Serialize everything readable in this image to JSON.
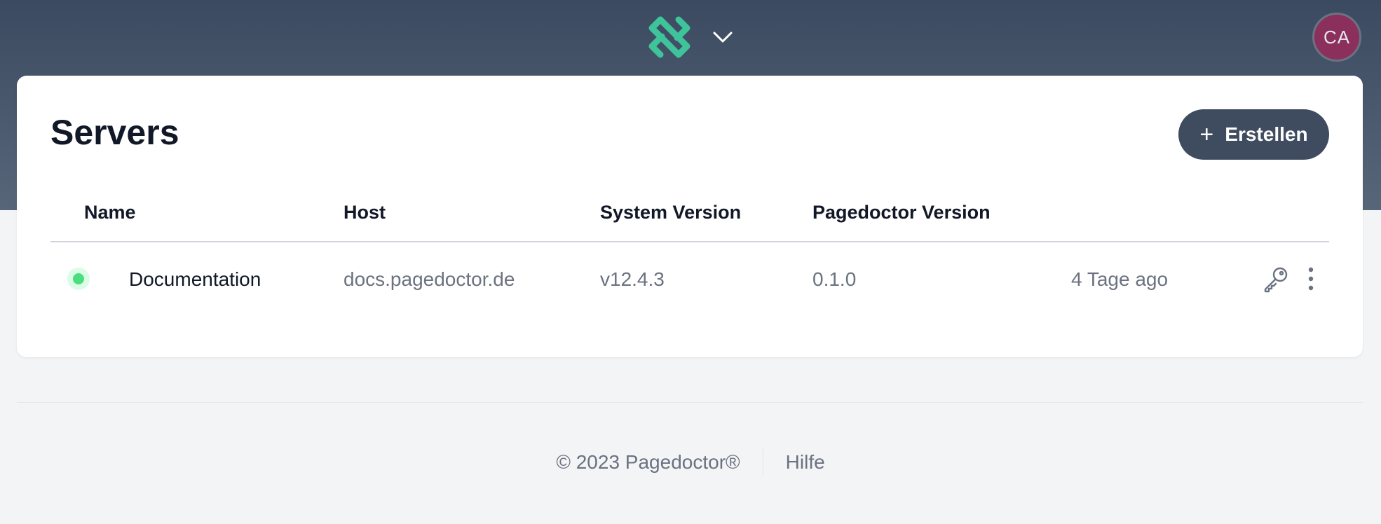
{
  "header": {
    "logo_icon": "pagedoctor-logo-icon",
    "dropdown_icon": "chevron-down-icon",
    "avatar_initials": "CA",
    "logo_color": "#3fc39a",
    "avatar_color": "#8b2f5c"
  },
  "page": {
    "title": "Servers",
    "create_label": "Erstellen",
    "create_icon": "plus-icon"
  },
  "table": {
    "columns": [
      "Name",
      "Host",
      "System Version",
      "Pagedoctor Version"
    ],
    "rows": [
      {
        "status": "online",
        "status_color": "#4ade80",
        "name": "Documentation",
        "host": "docs.pagedoctor.de",
        "system_version": "v12.4.3",
        "pagedoctor_version": "0.1.0",
        "updated": "4 Tage ago"
      }
    ]
  },
  "footer": {
    "copyright": "© 2023 Pagedoctor®",
    "help_label": "Hilfe"
  }
}
